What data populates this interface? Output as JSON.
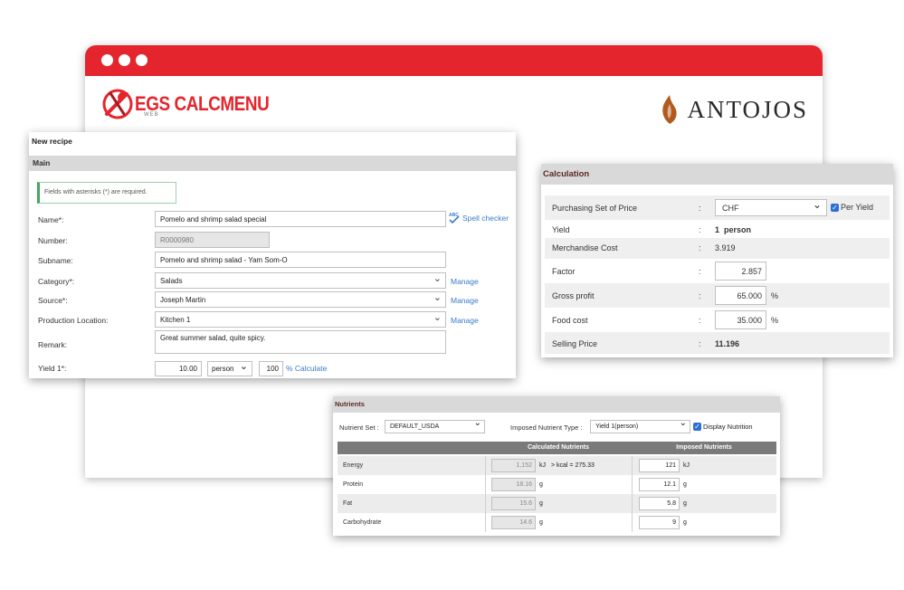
{
  "background": {
    "brand_left": "EGS CALCMENU",
    "brand_left_sub": "WEB",
    "brand_right": "ANTOJOS"
  },
  "recipe": {
    "title": "New recipe",
    "section": "Main",
    "note": "Fields with asterisks (*) are required.",
    "spell_checker": "Spell checker",
    "spell_abc": "ABC",
    "fields": {
      "name_label": "Name*:",
      "name_value": "Pomelo and shrimp salad special",
      "number_label": "Number:",
      "number_value": "R0000980",
      "subname_label": "Subname:",
      "subname_value": "Pomelo and shrimp salad - Yam Som-O",
      "category_label": "Category*:",
      "category_value": "Salads",
      "source_label": "Source*:",
      "source_value": "Joseph Martin",
      "production_label": "Production Location:",
      "production_value": "Kitchen 1",
      "remark_label": "Remark:",
      "remark_value": "Great summer salad, quite spicy.",
      "yield_label": "Yield 1*:",
      "yield_qty": "10.00",
      "yield_unit": "person",
      "yield_pct": "100",
      "yield_calc": "% Calculate"
    },
    "manage_label": "Manage"
  },
  "calculation": {
    "title": "Calculation",
    "purchasing_label": "Purchasing Set of Price",
    "purchasing_value": "CHF",
    "per_yield": "Per Yield",
    "yield_label": "Yield",
    "yield_value": "1  person",
    "merch_label": "Merchandise Cost",
    "merch_value": "3.919",
    "factor_label": "Factor",
    "factor_value": "2.857",
    "gross_label": "Gross profit",
    "gross_value": "65.000",
    "food_label": "Food cost",
    "food_value": "35.000",
    "selling_label": "Selling Price",
    "selling_value": "11.196",
    "colon": ":",
    "pct": "%"
  },
  "nutrients": {
    "title": "Nutrients",
    "set_label": "Nutrient Set :",
    "set_value": "DEFAULT_USDA",
    "imposed_type_label": "Imposed Nutrient Type :",
    "imposed_type_value": "Yield 1(person)",
    "display_label": "Display Nutrition",
    "col_calculated": "Calculated Nutrients",
    "col_imposed": "Imposed Nutrients",
    "rows": [
      {
        "name": "Energy",
        "calc": "1,152",
        "unit": "kJ",
        "extra": "> kcal = 275.33",
        "imposed": "121",
        "imp_unit": "kJ"
      },
      {
        "name": "Protein",
        "calc": "18.16",
        "unit": "g",
        "extra": "",
        "imposed": "12.1",
        "imp_unit": "g"
      },
      {
        "name": "Fat",
        "calc": "15.6",
        "unit": "g",
        "extra": "",
        "imposed": "5.8",
        "imp_unit": "g"
      },
      {
        "name": "Carbohydrate",
        "calc": "14.6",
        "unit": "g",
        "extra": "",
        "imposed": "9",
        "imp_unit": "g"
      }
    ]
  }
}
